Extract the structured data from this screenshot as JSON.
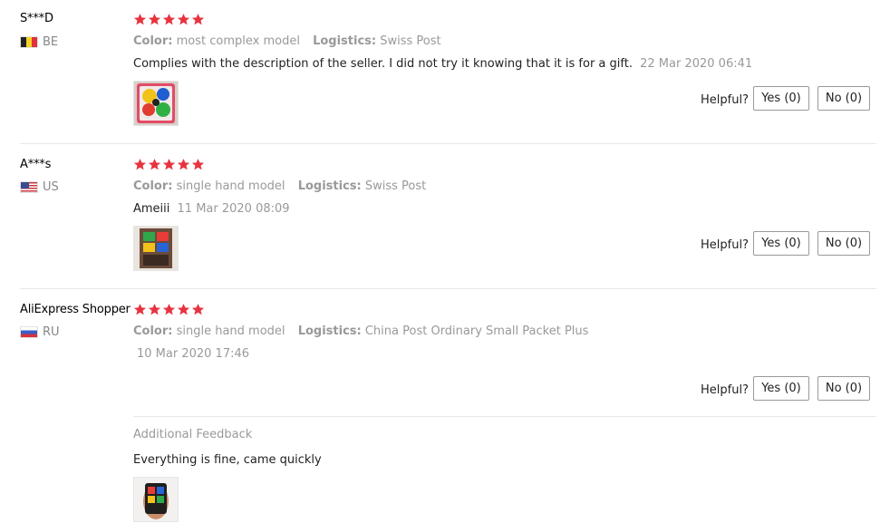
{
  "star_color": "#e8333f",
  "helpful_label": "Helpful?",
  "reviews": [
    {
      "user": "S***D",
      "country_code": "BE",
      "flag_icon": "belgium-flag-icon",
      "rating": 5,
      "color_label": "Color:",
      "color_value": "most complex model",
      "logistics_label": "Logistics:",
      "logistics_value": "Swiss Post",
      "text": "Complies with the description of the seller. I did not try it knowing that it is for a gift.",
      "date": "22 Mar 2020 06:41",
      "yes_label": "Yes (0)",
      "no_label": "No (0)"
    },
    {
      "user": "A***s",
      "country_code": "US",
      "flag_icon": "usa-flag-icon",
      "rating": 5,
      "color_label": "Color:",
      "color_value": "single hand model",
      "logistics_label": "Logistics:",
      "logistics_value": "Swiss Post",
      "text": "Ameiii",
      "date": "11 Mar 2020 08:09",
      "yes_label": "Yes (0)",
      "no_label": "No (0)"
    },
    {
      "user": "AliExpress Shopper",
      "country_code": "RU",
      "flag_icon": "russia-flag-icon",
      "rating": 5,
      "color_label": "Color:",
      "color_value": "single hand model",
      "logistics_label": "Logistics:",
      "logistics_value": "China Post Ordinary Small Packet Plus",
      "text": "",
      "date": "10 Mar 2020 17:46",
      "yes_label": "Yes (0)",
      "no_label": "No (0)",
      "additional_feedback_title": "Additional Feedback",
      "additional_feedback_text": "Everything is fine, came quickly"
    }
  ]
}
